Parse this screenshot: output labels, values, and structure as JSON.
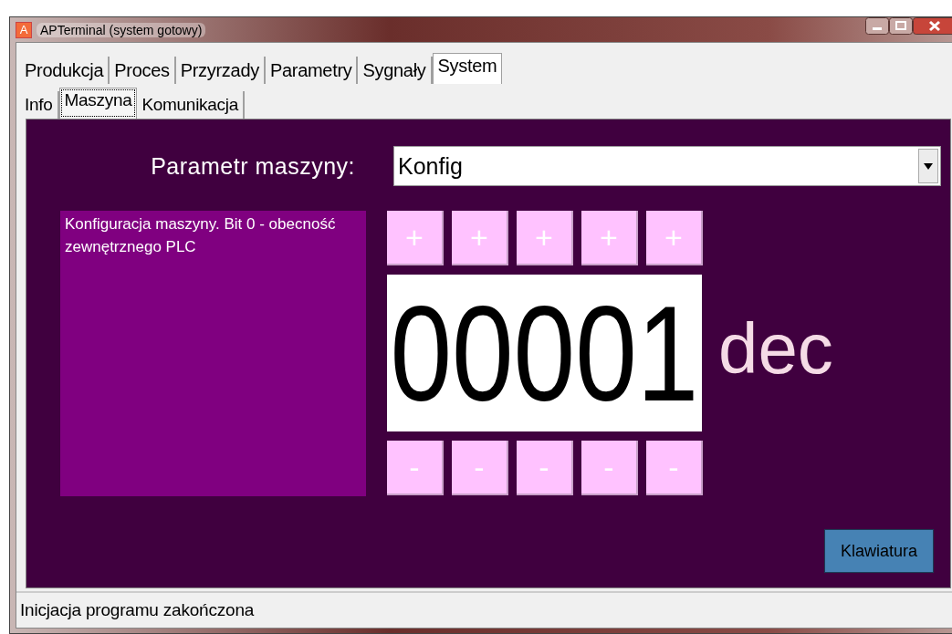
{
  "window": {
    "title": "APTerminal (system gotowy)",
    "app_icon": "A"
  },
  "tabs": [
    {
      "label": "Produkcja",
      "selected": false
    },
    {
      "label": "Proces",
      "selected": false
    },
    {
      "label": "Przyrzady",
      "selected": false
    },
    {
      "label": "Parametry",
      "selected": false
    },
    {
      "label": "Sygnały",
      "selected": false
    },
    {
      "label": "System",
      "selected": true
    }
  ],
  "subtabs": [
    {
      "label": "Info",
      "selected": false
    },
    {
      "label": "Maszyna",
      "selected": true
    },
    {
      "label": "Komunikacja",
      "selected": false
    }
  ],
  "parameter": {
    "label": "Parametr maszyny:",
    "value": "Konfig"
  },
  "description": "Konfiguracja maszyny. Bit 0 - obecność zewnętrznego PLC",
  "increment_buttons": [
    "+",
    "+",
    "+",
    "+",
    "+"
  ],
  "value": "00001",
  "unit": "dec",
  "decrement_buttons": [
    "-",
    "-",
    "-",
    "-",
    "-"
  ],
  "keyboard_button": "Klawiatura",
  "status_bar": "Inicjacja programu zakończona"
}
